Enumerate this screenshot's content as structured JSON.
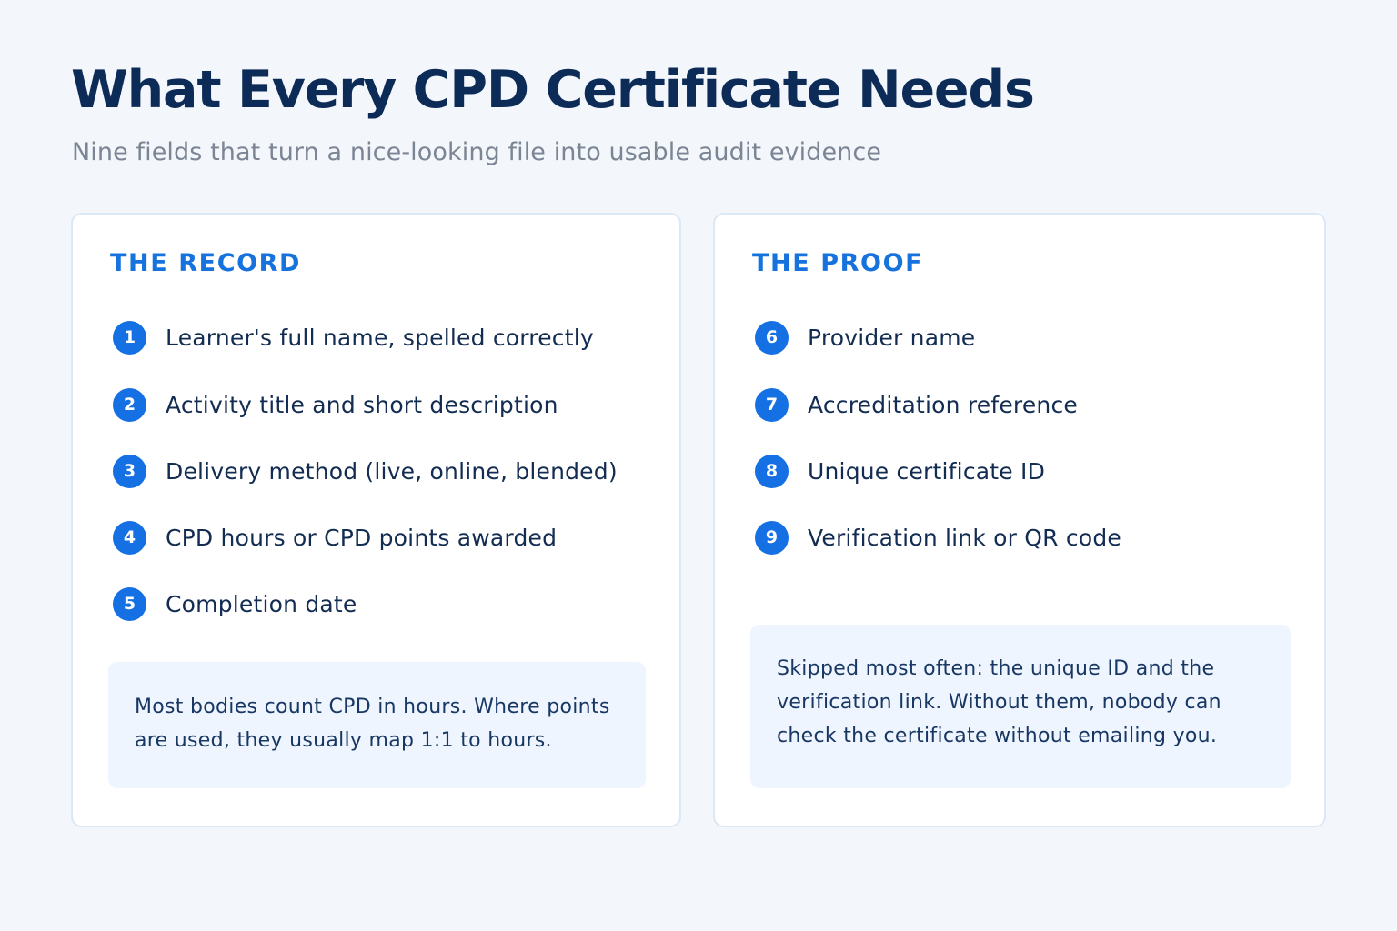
{
  "header": {
    "title": "What Every CPD Certificate Needs",
    "subtitle": "Nine fields that turn a nice-looking file into usable audit evidence"
  },
  "record_card": {
    "heading": "THE RECORD",
    "items": [
      {
        "number": "1",
        "label": "Learner's full name, spelled correctly"
      },
      {
        "number": "2",
        "label": "Activity title and short description"
      },
      {
        "number": "3",
        "label": "Delivery method (live, online, blended)"
      },
      {
        "number": "4",
        "label": "CPD hours or CPD points awarded"
      },
      {
        "number": "5",
        "label": "Completion date"
      }
    ],
    "note": "Most bodies count CPD in hours. Where points are used, they usually map 1:1 to hours."
  },
  "proof_card": {
    "heading": "THE PROOF",
    "items": [
      {
        "number": "6",
        "label": "Provider name"
      },
      {
        "number": "7",
        "label": "Accreditation reference"
      },
      {
        "number": "8",
        "label": "Unique certificate ID"
      },
      {
        "number": "9",
        "label": "Verification link or QR code"
      }
    ],
    "note": "Skipped most often: the unique ID and the verification link. Without them, nobody can check the certificate without emailing you."
  },
  "colors": {
    "background": "#f3f7fc",
    "title": "#0d2b57",
    "accent": "#1673dd",
    "badge": "#1570e4",
    "note_background": "#eef5fe"
  }
}
